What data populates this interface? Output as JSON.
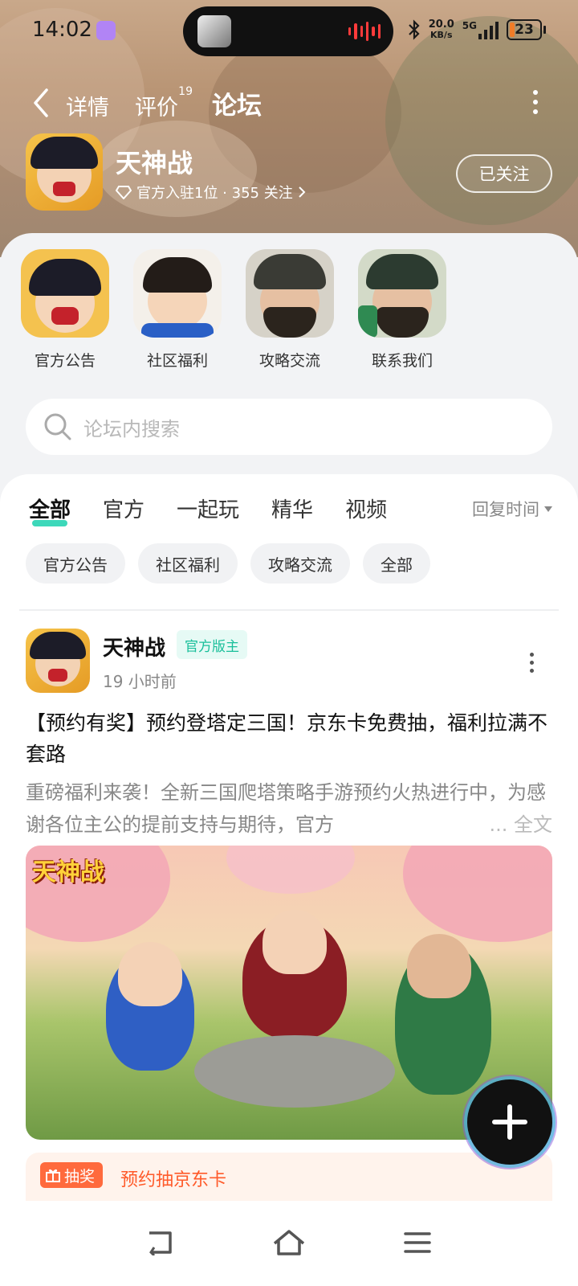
{
  "status_bar": {
    "time": "14:02",
    "net_speed": "20.0",
    "net_unit": "KB/s",
    "network": "5G",
    "battery": "23"
  },
  "nav": {
    "tabs": [
      {
        "label": "详情"
      },
      {
        "label": "评价",
        "count": "19"
      },
      {
        "label": "论坛"
      }
    ]
  },
  "game": {
    "name": "天神战",
    "meta": "官方入驻1位 · 355 关注",
    "follow_label": "已关注"
  },
  "categories": [
    {
      "label": "官方公告"
    },
    {
      "label": "社区福利"
    },
    {
      "label": "攻略交流"
    },
    {
      "label": "联系我们"
    }
  ],
  "search": {
    "placeholder": "论坛内搜索"
  },
  "filter_tabs": [
    {
      "label": "全部"
    },
    {
      "label": "官方"
    },
    {
      "label": "一起玩"
    },
    {
      "label": "精华"
    },
    {
      "label": "视频"
    }
  ],
  "sort_label": "回复时间",
  "chips": [
    {
      "label": "官方公告"
    },
    {
      "label": "社区福利"
    },
    {
      "label": "攻略交流"
    },
    {
      "label": "全部"
    }
  ],
  "post": {
    "author": "天神战",
    "badge": "官方版主",
    "time": "19 小时前",
    "title": "【预约有奖】预约登塔定三国！京东卡免费抽，福利拉满不套路",
    "excerpt": "重磅福利来袭！全新三国爬塔策略手游预约火热进行中，为感谢各位主公的提前支持与期待，官方",
    "more_label": "... 全文",
    "image_logo": "天神战"
  },
  "promo": {
    "tag": "抽奖",
    "text": "预约抽京东卡"
  },
  "colors": {
    "accent": "#28d4b3",
    "promo": "#ff5a2a"
  }
}
